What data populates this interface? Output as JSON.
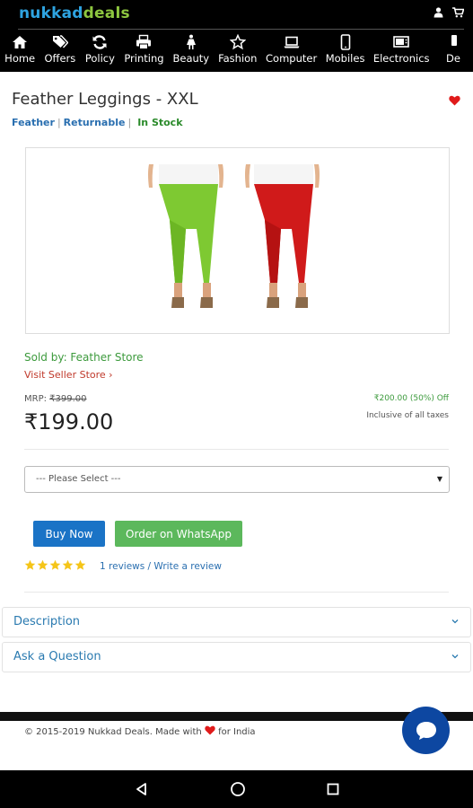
{
  "app": {
    "logo_part1": "nukkad",
    "logo_part2": "deals",
    "brand_color": "#2ea3e0",
    "brand_color2": "#8dc63f"
  },
  "top_icons": [
    "user-icon",
    "cart-icon"
  ],
  "nav": [
    {
      "label": "Home",
      "icon": "home-icon"
    },
    {
      "label": "Offers",
      "icon": "tags-icon"
    },
    {
      "label": "Policy",
      "icon": "refresh-icon"
    },
    {
      "label": "Printing",
      "icon": "printer-icon"
    },
    {
      "label": "Beauty",
      "icon": "female-icon"
    },
    {
      "label": "Fashion",
      "icon": "star-icon"
    },
    {
      "label": "Computer",
      "icon": "laptop-icon"
    },
    {
      "label": "Mobiles",
      "icon": "tablet-icon"
    },
    {
      "label": "Electronics",
      "icon": "tv-icon"
    },
    {
      "label": "De",
      "icon": "phone-icon"
    }
  ],
  "product": {
    "title": "Feather Leggings - XXL",
    "brand": "Feather",
    "returnable": "Returnable",
    "stock": "In Stock",
    "sold_by": "Sold by: Feather Store",
    "visit_store": "Visit Seller Store",
    "mrp_label": "MRP: ",
    "mrp_value": "₹399.00",
    "discount": "₹200.00 (50%) Off",
    "price": "₹199.00",
    "taxes": "Inclusive of all taxes",
    "select_placeholder": "--- Please Select ---",
    "buy_now": "Buy Now",
    "order_whatsapp": "Order on WhatsApp",
    "rating": 5,
    "reviews_text": "1 reviews / Write a review"
  },
  "accordion": {
    "description": "Description",
    "ask": "Ask a Question"
  },
  "footer": {
    "text_before": "© 2015-2019 Nukkad Deals. Made with ",
    "text_after": " for India"
  },
  "colors": {
    "buy_button": "#1a73c6",
    "whatsapp_button": "#5cb85c",
    "star": "#f5c518",
    "heart": "#e01b1b",
    "chat": "#0d47a1"
  }
}
